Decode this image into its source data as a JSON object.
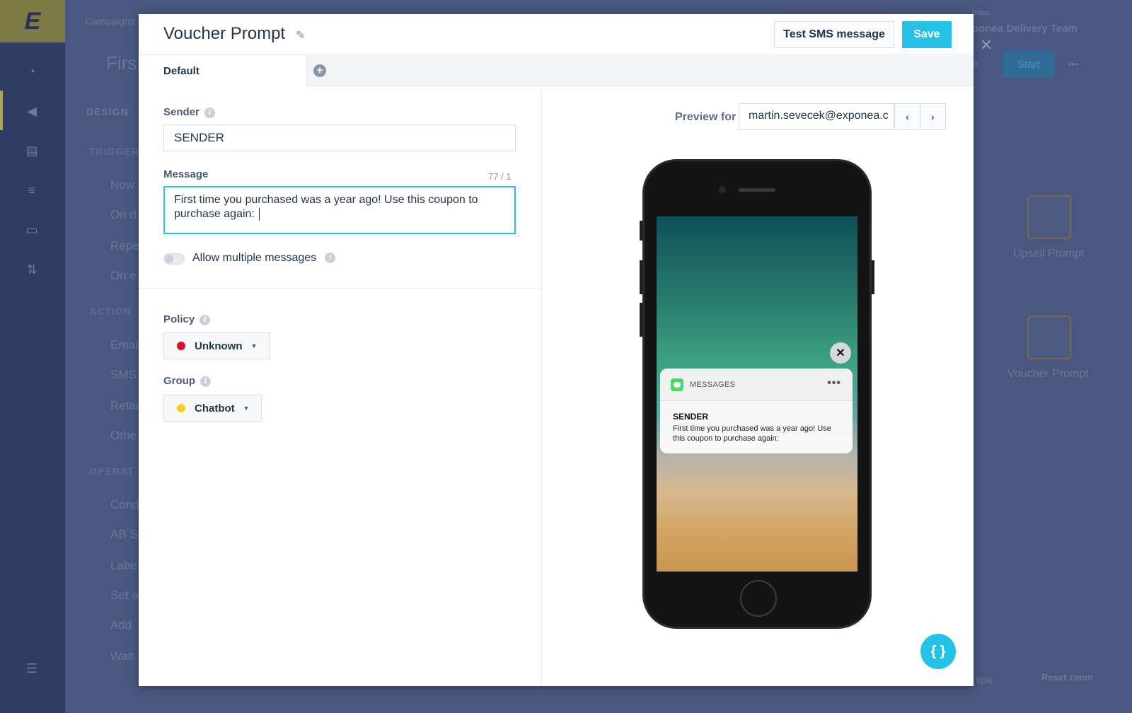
{
  "background": {
    "breadcrumb": "Campaigns",
    "page_title": "First",
    "design_tab": "DESIGN",
    "team_label": "onea",
    "team_name": "ponea Delivery Team",
    "start_label": "Start",
    "more_label": "•••",
    "left_partial": "e",
    "close_label": "✕",
    "sections": {
      "trigger": "TRIGGER",
      "action": "ACTION",
      "operat": "OPERAT"
    },
    "items": {
      "now": "Now",
      "on_d": "On d",
      "repe": "Repe",
      "on_e": "On e",
      "emai": "Emai",
      "sms": "SMS",
      "retar": "Retar",
      "othe": "Othe",
      "cond": "Cond",
      "ab_s": "AB S",
      "label": "Labe",
      "set_a": "Set a",
      "add": "Add",
      "wait": "Wait"
    },
    "nodes": {
      "upsell": "Upsell Prompt",
      "voucher": "Voucher Prompt"
    },
    "multiple": "tiple",
    "reset_zoom": "Reset zoom"
  },
  "modal": {
    "title": "Voucher Prompt",
    "test_button": "Test SMS message",
    "save_button": "Save",
    "tab_default": "Default",
    "tab_add": "+",
    "sender_label": "Sender",
    "sender_value": "SENDER",
    "message_label": "Message",
    "char_count": "77 / 1",
    "message_value": "First time you purchased was a year ago! Use this coupon to purchase again: ",
    "allow_multiple_label": "Allow multiple messages",
    "policy_label": "Policy",
    "policy_value": "Unknown",
    "group_label": "Group",
    "group_value": "Chatbot",
    "info_glyph": "i"
  },
  "preview": {
    "label": "Preview for",
    "email": "martin.sevecek@exponea.c",
    "prev": "‹",
    "next": "›",
    "notification": {
      "app": "MESSAGES",
      "more": "•••",
      "sender": "SENDER",
      "text": "First time you purchased was a year ago! Use this coupon to purchase again:"
    },
    "close": "✕",
    "fab": "{ }"
  },
  "colors": {
    "accent": "#26c1e6",
    "policy_dot": "#e0102a",
    "group_dot": "#f5d21c"
  },
  "icons": [
    "pencil-icon",
    "info-icon",
    "plus-circle-icon",
    "chevron-left-icon",
    "chevron-right-icon",
    "close-icon",
    "messages-app-icon",
    "code-braces-icon"
  ]
}
